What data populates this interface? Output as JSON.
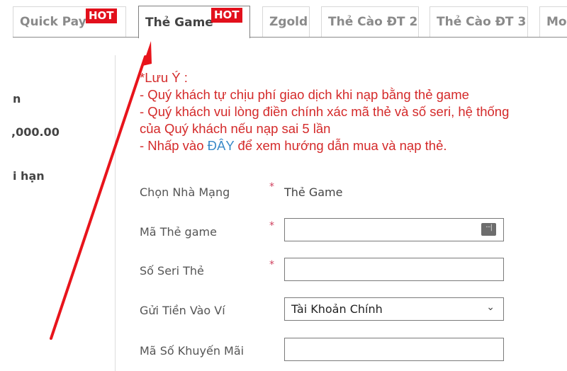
{
  "tabs": [
    {
      "label": "Quick Pay",
      "badge": "HOT",
      "active": false
    },
    {
      "label": "Thẻ Game",
      "badge": "HOT",
      "active": true
    },
    {
      "label": "Zgold",
      "badge": null,
      "active": false
    },
    {
      "label": "Thẻ Cào ĐT 2",
      "badge": null,
      "active": false
    },
    {
      "label": "Thẻ Cào ĐT 3",
      "badge": null,
      "active": false
    },
    {
      "label": "Mo",
      "badge": null,
      "active": false
    }
  ],
  "left_panel": {
    "frag1": "n",
    "frag2": ",000.00",
    "frag3": "i hạn"
  },
  "notes": {
    "title": "*Lưu Ý :",
    "line1": "- Quý khách tự chịu phí giao dịch khi nạp bằng thẻ game",
    "line2": "- Quý khách vui lòng điền chính xác mã thẻ và số seri, hệ thống",
    "line3": "của Quý khách nếu nạp sai 5 lần",
    "line4_prefix": "- Nhấp vào ",
    "line4_link": "ĐÂY",
    "line4_suffix": " để xem hướng dẫn mua và nạp thẻ."
  },
  "form": {
    "required_mark": "*",
    "provider_label": "Chọn Nhà Mạng",
    "provider_value": "Thẻ Game",
    "card_code_label": "Mã Thẻ game",
    "card_code_value": "",
    "serial_label": "Số Seri Thẻ",
    "serial_value": "",
    "wallet_label": "Gửi Tiền Vào Ví",
    "wallet_selected": "Tài Khoản Chính",
    "promo_label": "Mã Số Khuyến Mãi",
    "promo_value": ""
  },
  "icons": {
    "password_manager": "password-key-icon",
    "dropdown": "chevron-down-icon",
    "annotation": "red-arrow"
  },
  "colors": {
    "hot_badge": "#e2101c",
    "note_text": "#d42a2a",
    "link": "#3a8ac8",
    "arrow": "#e8141b"
  }
}
